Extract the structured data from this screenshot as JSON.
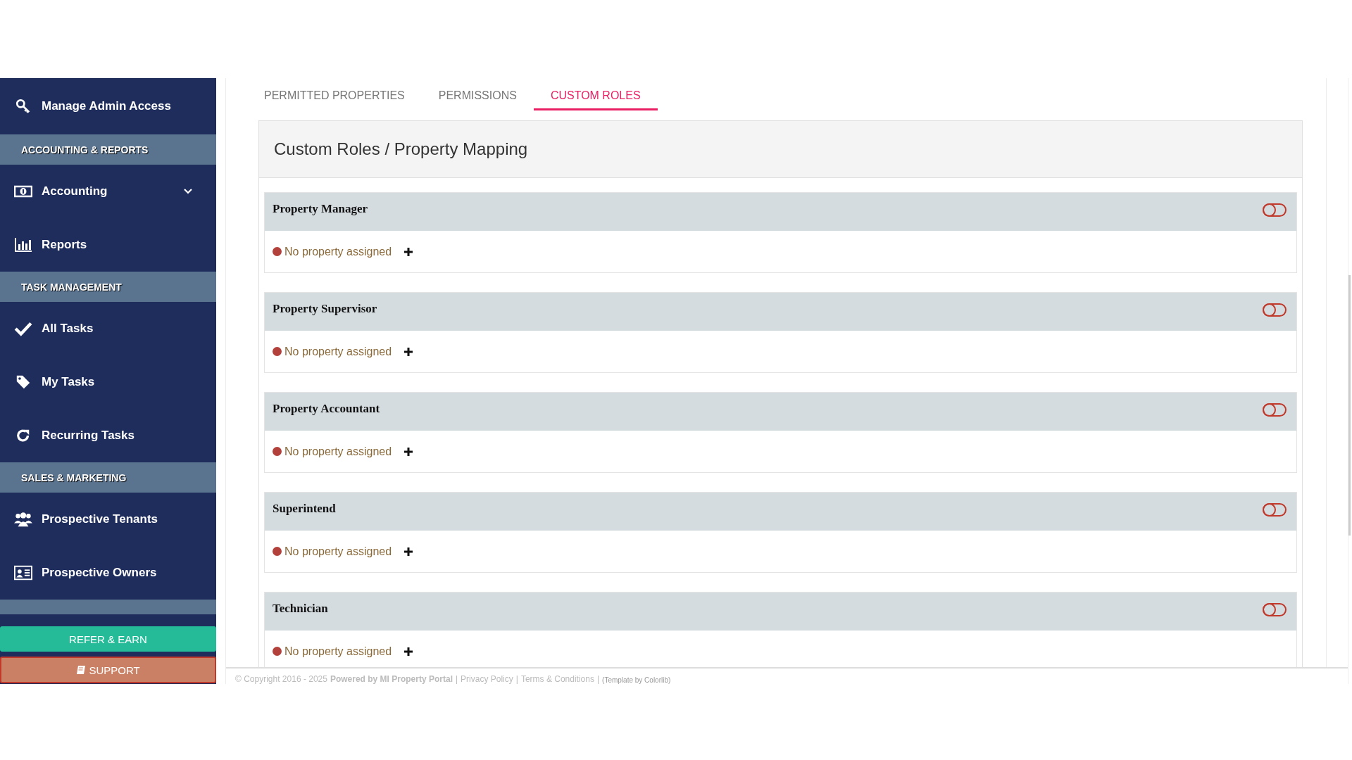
{
  "sidebar": {
    "items": [
      {
        "kind": "item",
        "label": "Manage Admin Access"
      },
      {
        "kind": "header",
        "label": "ACCOUNTING & REPORTS"
      },
      {
        "kind": "dropdown",
        "label": "Accounting",
        "expanded": false
      },
      {
        "kind": "item",
        "label": "Reports"
      },
      {
        "kind": "header",
        "label": "TASK MANAGEMENT"
      },
      {
        "kind": "item",
        "label": "All Tasks"
      },
      {
        "kind": "item",
        "label": "My Tasks"
      },
      {
        "kind": "item",
        "label": "Recurring Tasks"
      },
      {
        "kind": "header",
        "label": "SALES & MARKETING"
      },
      {
        "kind": "item",
        "label": "Prospective Tenants"
      },
      {
        "kind": "item",
        "label": "Prospective Owners"
      },
      {
        "kind": "spacer"
      }
    ],
    "refer_button": "REFER & EARN",
    "support_button": "SUPPORT"
  },
  "tabs": [
    {
      "label": "PERMITTED PROPERTIES",
      "selected": false
    },
    {
      "label": "PERMISSIONS",
      "selected": false
    },
    {
      "label": "CUSTOM ROLES",
      "selected": true
    }
  ],
  "card": {
    "title": "Custom Roles / Property Mapping",
    "roles": [
      {
        "name": "Property Manager",
        "on": false,
        "status": "No property assigned"
      },
      {
        "name": "Property Supervisor",
        "on": false,
        "status": "No property assigned"
      },
      {
        "name": "Property Accountant",
        "on": false,
        "status": "No property assigned"
      },
      {
        "name": "Superintend",
        "on": false,
        "status": "No property assigned"
      },
      {
        "name": "Technician",
        "on": false,
        "status": "No property assigned"
      }
    ]
  },
  "footer": [
    {
      "kind": "text",
      "text": "© Copyright 2016 - 2025"
    },
    {
      "kind": "strong",
      "text": "Powered by MI Property Portal"
    },
    {
      "kind": "sep",
      "text": "|"
    },
    {
      "kind": "link",
      "text": "Privacy Policy"
    },
    {
      "kind": "sep",
      "text": "|"
    },
    {
      "kind": "link",
      "text": "Terms & Conditions"
    },
    {
      "kind": "sep",
      "text": "|"
    },
    {
      "kind": "small",
      "text": "(Template by Colorlib)"
    }
  ]
}
